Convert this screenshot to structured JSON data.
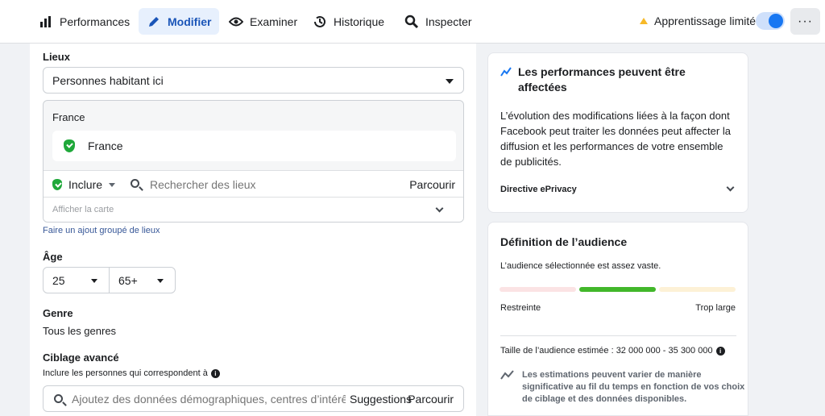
{
  "header": {
    "tabs": [
      {
        "label": "Performances",
        "icon": "bar-chart-icon"
      },
      {
        "label": "Modifier",
        "icon": "pencil-icon"
      },
      {
        "label": "Examiner",
        "icon": "eye-icon"
      },
      {
        "label": "Historique",
        "icon": "history-icon"
      },
      {
        "label": "Inspecter",
        "icon": "inspect-icon"
      }
    ],
    "learning_status": "Apprentissage limité",
    "more_label": "···"
  },
  "locations": {
    "title": "Lieux",
    "type_select": "Personnes habitant ici",
    "country_header": "France",
    "selected_location": "France",
    "include_label": "Inclure",
    "search_placeholder": "Rechercher des lieux",
    "browse_label": "Parcourir",
    "show_map_label": "Afficher la carte",
    "bulk_add_link": "Faire un ajout groupé de lieux"
  },
  "age": {
    "title": "Âge",
    "min": "25",
    "max": "65+"
  },
  "gender": {
    "title": "Genre",
    "value": "Tous les genres"
  },
  "detailed_targeting": {
    "title": "Ciblage avancé",
    "subtitle": "Inclure les personnes qui correspondent à",
    "search_placeholder": "Ajoutez des données démographiques, centres d’intérêt ou",
    "suggestions_label": "Suggestions",
    "browse_label": "Parcourir"
  },
  "performance_card": {
    "title_line1": "Les performances peuvent être",
    "title_line2": "affectées",
    "body_lines": [
      "L’évolution des modifications liées à la façon dont",
      "Facebook peut traiter les données peut affecter la",
      "diffusion et les performances de votre ensemble",
      "de publicités."
    ],
    "directive_label": "Directive ePrivacy"
  },
  "audience_card": {
    "title": "Définition de l’audience",
    "status": "L’audience sélectionnée est assez vaste.",
    "scale_left": "Restreinte",
    "scale_right": "Trop large",
    "estimate": "Taille de l’audience estimée : 32 000 000 - 35 300 000",
    "note_lines": [
      "Les estimations peuvent varier de manière",
      "significative au fil du temps en fonction de vos choix",
      "de ciblage et des données disponibles."
    ],
    "colors": {
      "narrow": "#fbe3e4",
      "good": "#42b72a",
      "broad": "#fdf1d6"
    }
  }
}
